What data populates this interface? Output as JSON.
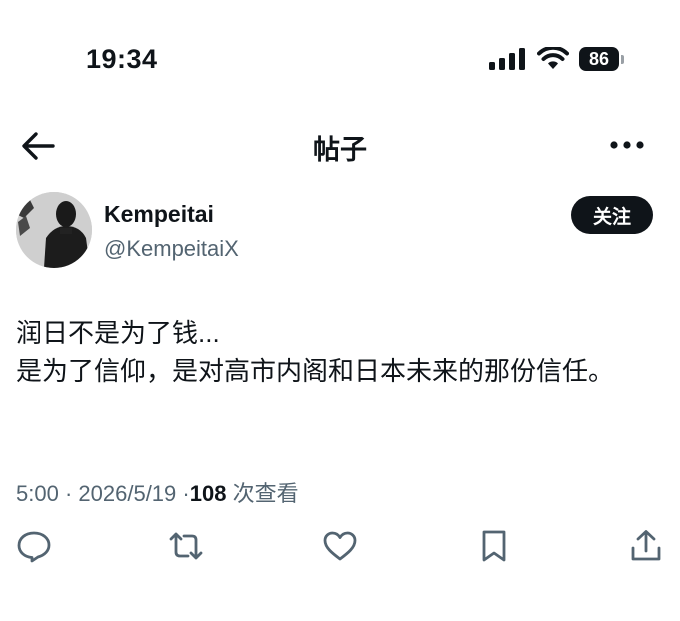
{
  "status_bar": {
    "time": "19:34",
    "battery": "86",
    "icons": [
      "signal-icon",
      "wifi-icon",
      "battery-icon"
    ]
  },
  "nav": {
    "title": "帖子",
    "back_icon": "back-arrow-icon",
    "more_icon": "more-icon"
  },
  "author": {
    "name": "Kempeitai",
    "handle": "@KempeitaiX",
    "follow_label": "关注"
  },
  "post": {
    "lines": [
      "润日不是为了钱...",
      "是为了信仰，是对高市内阁和日本未来的那份信任。"
    ]
  },
  "meta": {
    "time": "5:00",
    "sep1": "·",
    "date": "2026/5/19",
    "sep2": "·",
    "views_count": "108",
    "views_label": "次查看"
  },
  "actions": [
    "reply-icon",
    "repost-icon",
    "like-icon",
    "bookmark-icon",
    "share-icon"
  ],
  "colors": {
    "text": "#0f1419",
    "secondary": "#536471",
    "background": "#ffffff"
  }
}
